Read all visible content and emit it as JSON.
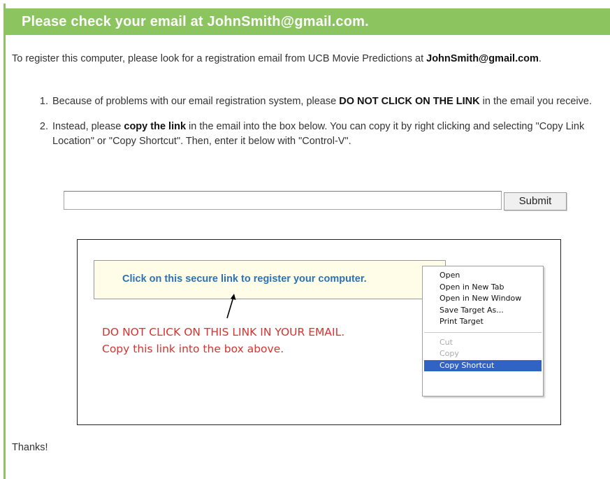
{
  "header": {
    "title": "Please check your email at JohnSmith@gmail.com."
  },
  "intro": {
    "text_before": "To register this computer, please look for a registration email from UCB Movie Predictions at ",
    "email": "JohnSmith@gmail.com",
    "text_after": "."
  },
  "steps": [
    {
      "before": "Because of problems with our email registration system, please ",
      "bold": "DO NOT CLICK ON THE LINK",
      "after": " in the email you receive."
    },
    {
      "before": "Instead, please ",
      "bold": "copy the link",
      "after": " in the email into the box below. You can copy it by right clicking and selecting \"Copy Link Location\" or \"Copy Shortcut\". Then, enter it below with \"Control-V\"."
    }
  ],
  "form": {
    "input_value": "",
    "input_placeholder": "",
    "submit_label": "Submit"
  },
  "illustration": {
    "link_text": "Click on this secure link to register your computer.",
    "warning_line1": "DO NOT CLICK ON THIS LINK IN YOUR EMAIL.",
    "warning_line2": "Copy this link into the box above.",
    "menu_items": [
      {
        "label": "Open",
        "state": "enabled"
      },
      {
        "label": "Open in New Tab",
        "state": "enabled"
      },
      {
        "label": "Open in New Window",
        "state": "enabled"
      },
      {
        "label": "Save Target As...",
        "state": "enabled"
      },
      {
        "label": "Print Target",
        "state": "enabled"
      },
      {
        "label": "Cut",
        "state": "disabled"
      },
      {
        "label": "Copy",
        "state": "disabled"
      },
      {
        "label": "Copy Shortcut",
        "state": "highlighted"
      }
    ]
  },
  "footer": {
    "thanks": "Thanks!"
  },
  "colors": {
    "accent_green": "#8cc460",
    "link_blue": "#2a72b5",
    "warning_red": "#d8332e",
    "menu_highlight": "#3163c5"
  }
}
